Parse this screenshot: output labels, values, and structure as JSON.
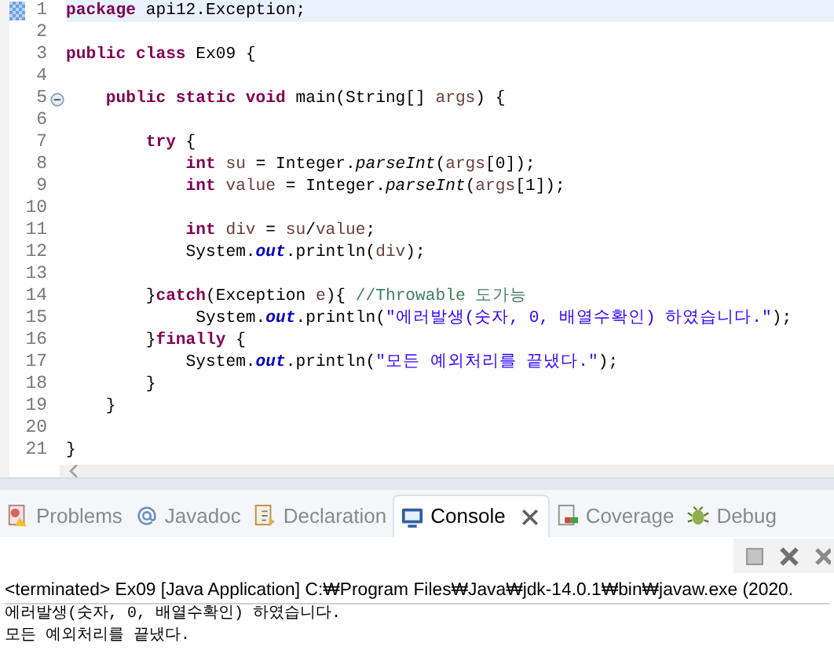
{
  "editor": {
    "lines": [
      {
        "number": "1",
        "current": true,
        "foldable": false,
        "tokens": [
          {
            "kind": "keyword",
            "text": "package"
          },
          {
            "kind": "plain",
            "text": " api12.Exception;"
          }
        ]
      },
      {
        "number": "2",
        "current": false,
        "foldable": false
      },
      {
        "number": "3",
        "current": false,
        "foldable": false,
        "tokens": [
          {
            "kind": "keyword",
            "text": "public class"
          },
          {
            "kind": "plain",
            "text": " Ex09 {"
          }
        ]
      },
      {
        "number": "4",
        "current": false,
        "foldable": false
      },
      {
        "number": "5",
        "current": false,
        "foldable": true,
        "tokens": [
          {
            "kind": "keyword",
            "text": "    public static void"
          },
          {
            "kind": "plain",
            "text": " main(String[] "
          },
          {
            "kind": "variable",
            "text": "args"
          },
          {
            "kind": "plain",
            "text": ") {"
          }
        ]
      },
      {
        "number": "6",
        "current": false,
        "foldable": false
      },
      {
        "number": "7",
        "current": false,
        "foldable": false,
        "tokens": [
          {
            "kind": "keyword",
            "text": "        try"
          },
          {
            "kind": "plain",
            "text": " {"
          }
        ]
      },
      {
        "number": "8",
        "current": false,
        "foldable": false,
        "tokens": [
          {
            "kind": "keyword",
            "text": "            int"
          },
          {
            "kind": "variable",
            "text": " su"
          },
          {
            "kind": "plain",
            "text": " = Integer."
          },
          {
            "kind": "static_method",
            "text": "parseInt"
          },
          {
            "kind": "plain",
            "text": "("
          },
          {
            "kind": "variable",
            "text": "args"
          },
          {
            "kind": "plain",
            "text": "[0]);"
          }
        ]
      },
      {
        "number": "9",
        "current": false,
        "foldable": false,
        "tokens": [
          {
            "kind": "keyword",
            "text": "            int"
          },
          {
            "kind": "variable",
            "text": " value"
          },
          {
            "kind": "plain",
            "text": " = Integer."
          },
          {
            "kind": "static_method",
            "text": "parseInt"
          },
          {
            "kind": "plain",
            "text": "("
          },
          {
            "kind": "variable",
            "text": "args"
          },
          {
            "kind": "plain",
            "text": "[1]);"
          }
        ]
      },
      {
        "number": "10",
        "current": false,
        "foldable": false
      },
      {
        "number": "11",
        "current": false,
        "foldable": false,
        "tokens": [
          {
            "kind": "keyword",
            "text": "            int"
          },
          {
            "kind": "variable",
            "text": " div"
          },
          {
            "kind": "plain",
            "text": " = "
          },
          {
            "kind": "variable",
            "text": "su"
          },
          {
            "kind": "plain",
            "text": "/"
          },
          {
            "kind": "variable",
            "text": "value"
          },
          {
            "kind": "plain",
            "text": ";"
          }
        ]
      },
      {
        "number": "12",
        "current": false,
        "foldable": false,
        "tokens": [
          {
            "kind": "plain",
            "text": "            System."
          },
          {
            "kind": "static_field",
            "text": "out"
          },
          {
            "kind": "plain",
            "text": ".println("
          },
          {
            "kind": "variable",
            "text": "div"
          },
          {
            "kind": "plain",
            "text": ");"
          }
        ]
      },
      {
        "number": "13",
        "current": false,
        "foldable": false
      },
      {
        "number": "14",
        "current": false,
        "foldable": false,
        "tokens": [
          {
            "kind": "plain",
            "text": "        }"
          },
          {
            "kind": "keyword",
            "text": "catch"
          },
          {
            "kind": "plain",
            "text": "(Exception "
          },
          {
            "kind": "variable",
            "text": "e"
          },
          {
            "kind": "plain",
            "text": "){ "
          },
          {
            "kind": "comment",
            "text": "//Throwable 도가능"
          }
        ]
      },
      {
        "number": "15",
        "current": false,
        "foldable": false,
        "tokens": [
          {
            "kind": "plain",
            "text": "             System."
          },
          {
            "kind": "static_field",
            "text": "out"
          },
          {
            "kind": "plain",
            "text": ".println("
          },
          {
            "kind": "string",
            "text": "\"에러발생(숫자, 0, 배열수확인) 하였습니다.\""
          },
          {
            "kind": "plain",
            "text": ");"
          }
        ]
      },
      {
        "number": "16",
        "current": false,
        "foldable": false,
        "tokens": [
          {
            "kind": "plain",
            "text": "        }"
          },
          {
            "kind": "keyword",
            "text": "finally"
          },
          {
            "kind": "plain",
            "text": " {"
          }
        ]
      },
      {
        "number": "17",
        "current": false,
        "foldable": false,
        "tokens": [
          {
            "kind": "plain",
            "text": "            System."
          },
          {
            "kind": "static_field",
            "text": "out"
          },
          {
            "kind": "plain",
            "text": ".println("
          },
          {
            "kind": "string",
            "text": "\"모든 예외처리를 끝냈다.\""
          },
          {
            "kind": "plain",
            "text": ");"
          }
        ]
      },
      {
        "number": "18",
        "current": false,
        "foldable": false,
        "tokens": [
          {
            "kind": "plain",
            "text": "        }"
          }
        ]
      },
      {
        "number": "19",
        "current": false,
        "foldable": false,
        "tokens": [
          {
            "kind": "plain",
            "text": "    }"
          }
        ]
      },
      {
        "number": "20",
        "current": false,
        "foldable": false
      },
      {
        "number": "21",
        "current": false,
        "foldable": false,
        "tokens": [
          {
            "kind": "plain",
            "text": "}"
          }
        ]
      }
    ]
  },
  "tabs": [
    {
      "label": "Problems",
      "selected": false
    },
    {
      "label": "Javadoc",
      "selected": false
    },
    {
      "label": "Declaration",
      "selected": false
    },
    {
      "label": "Console",
      "selected": true
    },
    {
      "label": "Coverage",
      "selected": false
    },
    {
      "label": "Debug",
      "selected": false
    }
  ],
  "console": {
    "header": "<terminated> Ex09 [Java Application] C:₩Program Files₩Java₩jdk-14.0.1₩bin₩javaw.exe  (2020.",
    "output": [
      "에러발생(숫자, 0, 배열수확인) 하였습니다.",
      "모든 예외처리를 끝냈다."
    ]
  }
}
